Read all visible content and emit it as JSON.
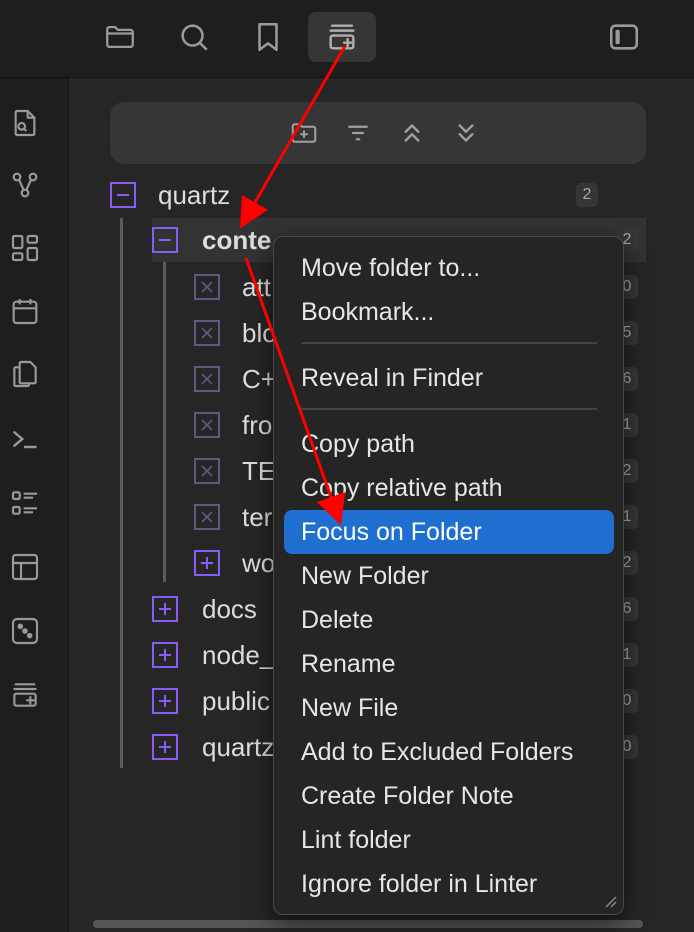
{
  "toolbar": {
    "icons": [
      "folder-icon",
      "search-icon",
      "bookmark-icon",
      "new-tab-stack-icon",
      "sidebar-toggle-icon"
    ]
  },
  "ribbon": {
    "icons": [
      "file-search-icon",
      "graph-icon",
      "dashboard-icon",
      "calendar-icon",
      "copy-icon",
      "terminal-icon",
      "list-icon",
      "layout-icon",
      "dice-icon",
      "stack-add-icon"
    ]
  },
  "nav_actions": {
    "icons": [
      "new-folder-icon",
      "sort-icon",
      "collapse-all-icon",
      "expand-all-icon"
    ]
  },
  "tree": {
    "root": {
      "label": "quartz",
      "count": "2"
    },
    "content": {
      "label": "conte",
      "count": "2"
    },
    "children": [
      {
        "label": "att",
        "count": "0"
      },
      {
        "label": "blo",
        "count": "5"
      },
      {
        "label": "C+",
        "count": "6"
      },
      {
        "label": "fro",
        "count": "1"
      },
      {
        "label": "TE",
        "count": "2"
      },
      {
        "label": "ter",
        "count": "1"
      },
      {
        "label": "wo",
        "count": "2"
      }
    ],
    "siblings": [
      {
        "label": "docs",
        "count": "6"
      },
      {
        "label": "node_",
        "count": "1"
      },
      {
        "label": "public",
        "count": "0"
      },
      {
        "label": "quartz",
        "count": "0"
      }
    ]
  },
  "context_menu": {
    "group1": [
      "Move folder to...",
      "Bookmark..."
    ],
    "group2": [
      "Reveal in Finder"
    ],
    "group3": [
      "Copy path",
      "Copy relative path",
      "Focus on Folder",
      "New Folder",
      "Delete",
      "Rename",
      "New File",
      "Add to Excluded Folders",
      "Create Folder Note",
      "Lint folder",
      "Ignore folder in Linter"
    ],
    "highlighted": "Focus on Folder"
  },
  "colors": {
    "accent": "#8a5cf5",
    "highlight": "#1f6fd0",
    "arrow": "#ff0000"
  }
}
